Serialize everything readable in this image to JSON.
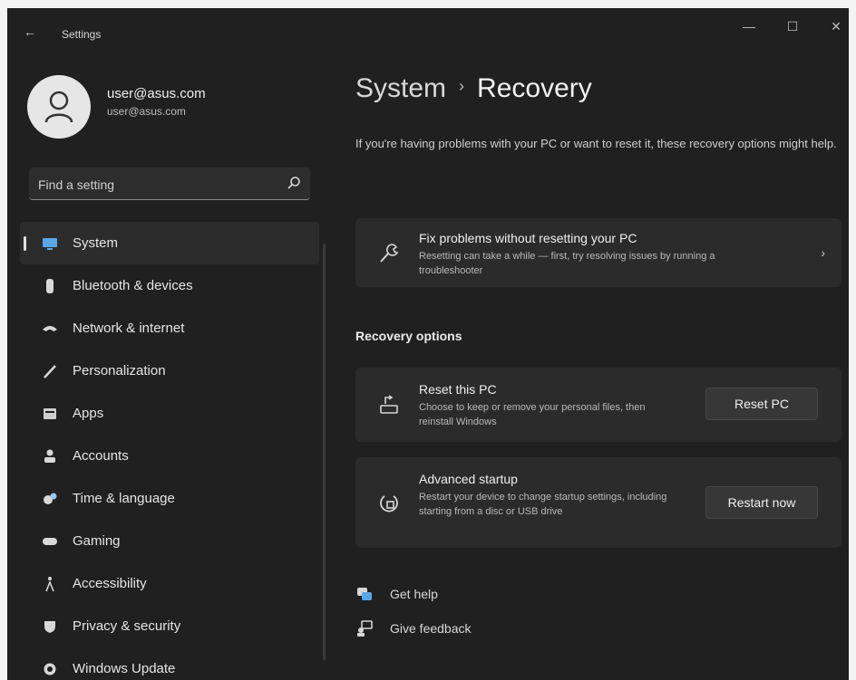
{
  "window": {
    "title": "Settings",
    "back": "←",
    "controls": {
      "minimize": "—",
      "maximize": "☐",
      "close": "✕"
    }
  },
  "user": {
    "name": "user@asus.com",
    "email": "user@asus.com"
  },
  "search": {
    "placeholder": "Find a setting"
  },
  "sidebar": {
    "items": [
      {
        "label": "System",
        "icon": "monitor-icon",
        "selected": true
      },
      {
        "label": "Bluetooth & devices",
        "icon": "bluetooth-icon"
      },
      {
        "label": "Network & internet",
        "icon": "wifi-icon"
      },
      {
        "label": "Personalization",
        "icon": "brush-icon"
      },
      {
        "label": "Apps",
        "icon": "apps-icon"
      },
      {
        "label": "Accounts",
        "icon": "person-icon"
      },
      {
        "label": "Time & language",
        "icon": "clock-globe-icon"
      },
      {
        "label": "Gaming",
        "icon": "gamepad-icon"
      },
      {
        "label": "Accessibility",
        "icon": "accessibility-icon"
      },
      {
        "label": "Privacy & security",
        "icon": "shield-icon"
      },
      {
        "label": "Windows Update",
        "icon": "update-icon"
      }
    ]
  },
  "main": {
    "breadcrumb": {
      "parent": "System",
      "separator": "›",
      "current": "Recovery"
    },
    "intro": "If you're having problems with your PC or want to reset it, these recovery options might help.",
    "fix_card": {
      "title": "Fix problems without resetting your PC",
      "description": "Resetting can take a while — first, try resolving issues by running a troubleshooter",
      "icon": "wrench-icon"
    },
    "section_title": "Recovery options",
    "reset_card": {
      "title": "Reset this PC",
      "description": "Choose to keep or remove your personal files, then reinstall Windows",
      "button": "Reset PC",
      "icon": "reset-pc-icon"
    },
    "advanced_card": {
      "title": "Advanced startup",
      "description": "Restart your device to change startup settings, including starting from a disc or USB drive",
      "button": "Restart now",
      "icon": "advanced-startup-icon"
    },
    "links": [
      {
        "label": "Get help",
        "icon": "help-icon"
      },
      {
        "label": "Give feedback",
        "icon": "feedback-icon"
      }
    ]
  }
}
